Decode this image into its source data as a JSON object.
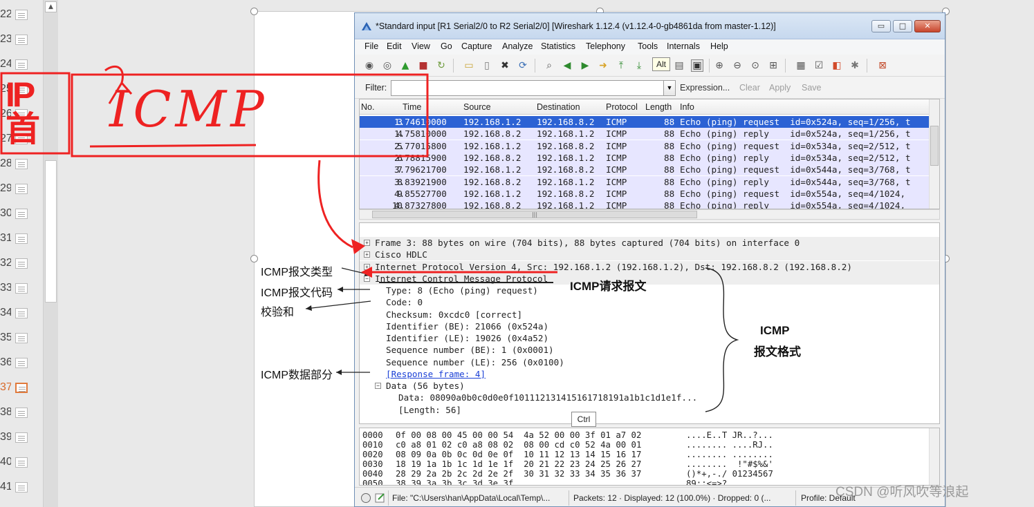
{
  "thumbnails": [
    {
      "num": "22",
      "active": false
    },
    {
      "num": "23",
      "active": false
    },
    {
      "num": "24",
      "active": false
    },
    {
      "num": "25",
      "active": false
    },
    {
      "num": "26",
      "active": false
    },
    {
      "num": "27",
      "active": false
    },
    {
      "num": "28",
      "active": false
    },
    {
      "num": "29",
      "active": false
    },
    {
      "num": "30",
      "active": false
    },
    {
      "num": "31",
      "active": false
    },
    {
      "num": "32",
      "active": false
    },
    {
      "num": "33",
      "active": false
    },
    {
      "num": "34",
      "active": false
    },
    {
      "num": "35",
      "active": false
    },
    {
      "num": "36",
      "active": false
    },
    {
      "num": "37",
      "active": true
    },
    {
      "num": "38",
      "active": false
    },
    {
      "num": "39",
      "active": false
    },
    {
      "num": "40",
      "active": false
    },
    {
      "num": "41",
      "active": false
    }
  ],
  "wireshark": {
    "title": "*Standard input   [R1 Serial2/0 to R2 Serial2/0]   [Wireshark 1.12.4  (v1.12.4-0-gb4861da from master-1.12)]",
    "window_buttons": {
      "minimize": "▭",
      "maximize": "□",
      "close": "✕"
    },
    "menu": [
      "File",
      "Edit",
      "View",
      "Go",
      "Capture",
      "Analyze",
      "Statistics",
      "Telephony",
      "Tools",
      "Internals",
      "Help"
    ],
    "toolbar_tooltip": "Alt",
    "filter": {
      "label": "Filter:",
      "value": "",
      "dropdown": "▼",
      "expression": "Expression...",
      "clear": "Clear",
      "apply": "Apply",
      "save": "Save"
    },
    "columns": [
      "No.",
      "Time",
      "Source",
      "Destination",
      "Protocol",
      "Length",
      "Info"
    ],
    "packets": [
      {
        "no": "3",
        "time": "1.74610000",
        "src": "192.168.1.2",
        "dst": "192.168.8.2",
        "proto": "ICMP",
        "len": "88",
        "info": "Echo (ping) request  id=0x524a, seq=1/256, t",
        "selected": true
      },
      {
        "no": "4",
        "time": "1.75810000",
        "src": "192.168.8.2",
        "dst": "192.168.1.2",
        "proto": "ICMP",
        "len": "88",
        "info": "Echo (ping) reply    id=0x524a, seq=1/256, t",
        "selected": false
      },
      {
        "no": "5",
        "time": "2.77015800",
        "src": "192.168.1.2",
        "dst": "192.168.8.2",
        "proto": "ICMP",
        "len": "88",
        "info": "Echo (ping) request  id=0x534a, seq=2/512, t",
        "selected": false
      },
      {
        "no": "6",
        "time": "2.78815900",
        "src": "192.168.8.2",
        "dst": "192.168.1.2",
        "proto": "ICMP",
        "len": "88",
        "info": "Echo (ping) reply    id=0x534a, seq=2/512, t",
        "selected": false
      },
      {
        "no": "7",
        "time": "3.79621700",
        "src": "192.168.1.2",
        "dst": "192.168.8.2",
        "proto": "ICMP",
        "len": "88",
        "info": "Echo (ping) request  id=0x544a, seq=3/768, t",
        "selected": false
      },
      {
        "no": "8",
        "time": "3.83921900",
        "src": "192.168.8.2",
        "dst": "192.168.1.2",
        "proto": "ICMP",
        "len": "88",
        "info": "Echo (ping) reply    id=0x544a, seq=3/768, t",
        "selected": false
      },
      {
        "no": "9",
        "time": "4.85527700",
        "src": "192.168.1.2",
        "dst": "192.168.8.2",
        "proto": "ICMP",
        "len": "88",
        "info": "Echo (ping) request  id=0x554a, seq=4/1024,",
        "selected": false
      },
      {
        "no": "10",
        "time": "4.87327800",
        "src": "192.168.8.2",
        "dst": "192.168.1.2",
        "proto": "ICMP",
        "len": "88",
        "info": "Echo (ping) reply    id=0x554a, seq=4/1024,",
        "selected": false
      }
    ],
    "details": [
      {
        "text": "Frame 3: 88 bytes on wire (704 bits), 88 bytes captured (704 bits) on interface 0",
        "level": 0,
        "expander": "+",
        "hdr": true,
        "link": false
      },
      {
        "text": "Cisco HDLC",
        "level": 0,
        "expander": "+",
        "hdr": true,
        "link": false
      },
      {
        "text": "Internet Protocol Version 4, Src: 192.168.1.2 (192.168.1.2), Dst: 192.168.8.2 (192.168.8.2)",
        "level": 0,
        "expander": "+",
        "hdr": true,
        "link": false
      },
      {
        "text": "Internet Control Message Protocol",
        "level": 0,
        "expander": "−",
        "hdr": true,
        "link": false
      },
      {
        "text": "Type: 8 (Echo (ping) request)",
        "level": 1,
        "expander": "",
        "hdr": false,
        "link": false
      },
      {
        "text": "Code: 0",
        "level": 1,
        "expander": "",
        "hdr": false,
        "link": false
      },
      {
        "text": "Checksum: 0xcdc0 [correct]",
        "level": 1,
        "expander": "",
        "hdr": false,
        "link": false
      },
      {
        "text": "Identifier (BE): 21066 (0x524a)",
        "level": 1,
        "expander": "",
        "hdr": false,
        "link": false
      },
      {
        "text": "Identifier (LE): 19026 (0x4a52)",
        "level": 1,
        "expander": "",
        "hdr": false,
        "link": false
      },
      {
        "text": "Sequence number (BE): 1 (0x0001)",
        "level": 1,
        "expander": "",
        "hdr": false,
        "link": false
      },
      {
        "text": "Sequence number (LE): 256 (0x0100)",
        "level": 1,
        "expander": "",
        "hdr": false,
        "link": false
      },
      {
        "text": "[Response frame: 4]",
        "level": 1,
        "expander": "",
        "hdr": false,
        "link": true
      },
      {
        "text": "Data (56 bytes)",
        "level": 1,
        "expander": "−",
        "hdr": true,
        "link": false
      },
      {
        "text": "Data: 08090a0b0c0d0e0f101112131415161718191a1b1c1d1e1f...",
        "level": 2,
        "expander": "",
        "hdr": false,
        "link": false
      },
      {
        "text": "[Length: 56]",
        "level": 2,
        "expander": "",
        "hdr": false,
        "link": false
      }
    ],
    "ctrl_tooltip": "Ctrl",
    "hex": [
      {
        "off": "0000",
        "bytes": "0f 00 08 00 45 00 00 54  4a 52 00 00 3f 01 a7 02",
        "ascii": "....E..T JR..?..."
      },
      {
        "off": "0010",
        "bytes": "c0 a8 01 02 c0 a8 08 02  08 00 cd c0 52 4a 00 01",
        "ascii": "........ ....RJ.."
      },
      {
        "off": "0020",
        "bytes": "08 09 0a 0b 0c 0d 0e 0f  10 11 12 13 14 15 16 17",
        "ascii": "........ ........"
      },
      {
        "off": "0030",
        "bytes": "18 19 1a 1b 1c 1d 1e 1f  20 21 22 23 24 25 26 27",
        "ascii": "........  !\"#$%&'"
      },
      {
        "off": "0040",
        "bytes": "28 29 2a 2b 2c 2d 2e 2f  30 31 32 33 34 35 36 37",
        "ascii": "()*+,-./ 01234567"
      },
      {
        "off": "0050",
        "bytes": "38 39 3a 3b 3c 3d 3e 3f",
        "ascii": "89:;<=>?"
      }
    ],
    "status": {
      "file": "File: \"C:\\Users\\han\\AppData\\Local\\Temp\\...",
      "packets": "Packets: 12 · Displayed: 12 (100.0%) · Dropped: 0 (...",
      "profile": "Profile: Default"
    }
  },
  "annotations": {
    "type_label": "ICMP报文类型",
    "code_label": "ICMP报文代码",
    "checksum_label": "校验和",
    "data_label": "ICMP数据部分",
    "request_label": "ICMP请求报文",
    "format_title_1": "ICMP",
    "format_title_2": "报文格式",
    "handwritten_ip": "IP首",
    "handwritten_icmp": "ICMP"
  },
  "watermark": "CSDN @听风吹等浪起",
  "colors": {
    "selection": "#2c62d4",
    "row_bg": "#e7e6ff",
    "annotation_red": "#ee2222"
  }
}
